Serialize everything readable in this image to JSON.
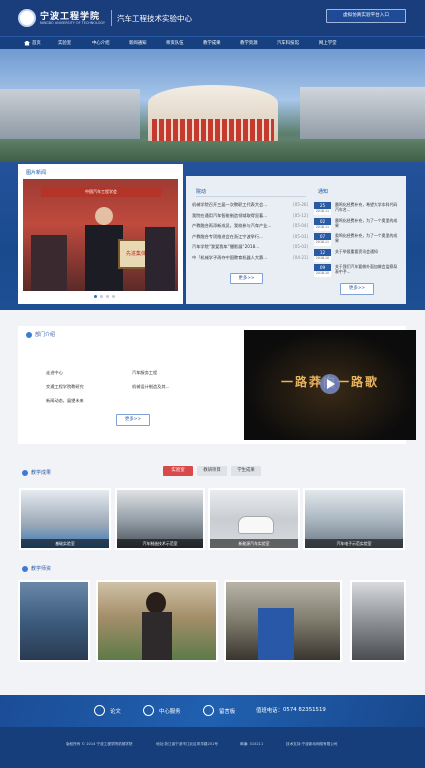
{
  "header": {
    "school_cn": "宁波工程学院",
    "school_en": "NINGBO UNIVERSITY OF TECHNOLOGY",
    "site_name": "汽车工程技术实验中心",
    "login_button": "虚拟仿真实验平台入口"
  },
  "nav": [
    {
      "label": "首页",
      "icon": "home-icon"
    },
    {
      "label": "实验室"
    },
    {
      "label": "中心介绍"
    },
    {
      "label": "新闻通知"
    },
    {
      "label": "师资队伍"
    },
    {
      "label": "教学成果"
    },
    {
      "label": "教学资源"
    },
    {
      "label": "汽车科技馆"
    },
    {
      "label": "网上学堂"
    }
  ],
  "news": {
    "title": "图片新闻",
    "photo_banner": "中国汽车工程学会",
    "photo_sign": "先进集体"
  },
  "dynamics": {
    "title": "院动",
    "items": [
      {
        "text": "机械学院召开三届一次教职工代表大会...",
        "date": "[05-26]"
      },
      {
        "text": "我院在通用汽车智能制造领域取得显著...",
        "date": "[05-12]"
      },
      {
        "text": "产教融合再添新成员，我校参与汽车产业...",
        "date": "[05-04]"
      },
      {
        "text": "产教融合专项推进会在浙江宁波举行...",
        "date": "[05-03]"
      },
      {
        "text": "汽车学院“我爱我车”摄影展“2018...",
        "date": "[05-03]"
      },
      {
        "text": "中「机械学子再夺中国教育机器人大赛...",
        "date": "[04-21]"
      }
    ],
    "more": "更多>>"
  },
  "notices": {
    "title": "通知",
    "items": [
      {
        "day": "25",
        "ym": "2018.11",
        "text": "晨鸣化经费补充，希望大学本科代码汽车名..."
      },
      {
        "day": "02",
        "ym": "2018.11",
        "text": "晨鸣化经费补充，为了一个奥里的成果"
      },
      {
        "day": "07",
        "ym": "2018.11",
        "text": "奥鸣化经费补充，为了一个奥里的成果"
      },
      {
        "day": "12",
        "ym": "2018.10",
        "text": "关于举报重要资讯会通知"
      },
      {
        "day": "09",
        "ym": "2018.10",
        "text": "关于我们汽车要做外面加做会监察局表中予..."
      }
    ],
    "more": "更多>>"
  },
  "intro": {
    "title": "部门介绍",
    "links": [
      "走进中心",
      "汽车服务工程",
      "交通工程学院教研究",
      "机械设计制造及其...",
      "新闻动态，展望未来"
    ],
    "more": "更多>>",
    "video_title": "一路莽向一路歌"
  },
  "achievements": {
    "title": "教学成果",
    "tabs": [
      "实验室",
      "教研项目",
      "学生成果"
    ],
    "captions": [
      "基础实验室",
      "汽车制造技术示范室",
      "新能源汽车实验室",
      "汽车电子示范实验室"
    ]
  },
  "teachers": {
    "title": "教学师资"
  },
  "footer": {
    "links": [
      "论文",
      "中心服务",
      "留言板"
    ],
    "phone_label": "值班电话：",
    "phone": "0574 82351519",
    "copyright": "版权所有 © 2014 宁波工程学院机械学院",
    "address": "地址:浙江省宁波市江北区风华路201号",
    "postcode": "邮编: 315211",
    "support": "技术支持:宁波新动网络有限公司"
  },
  "colors": {
    "brand": "#1a3d7c",
    "accent": "#2a6fc8",
    "notice_day": "#2a5aa4",
    "tab_active": "#d84a4a"
  }
}
